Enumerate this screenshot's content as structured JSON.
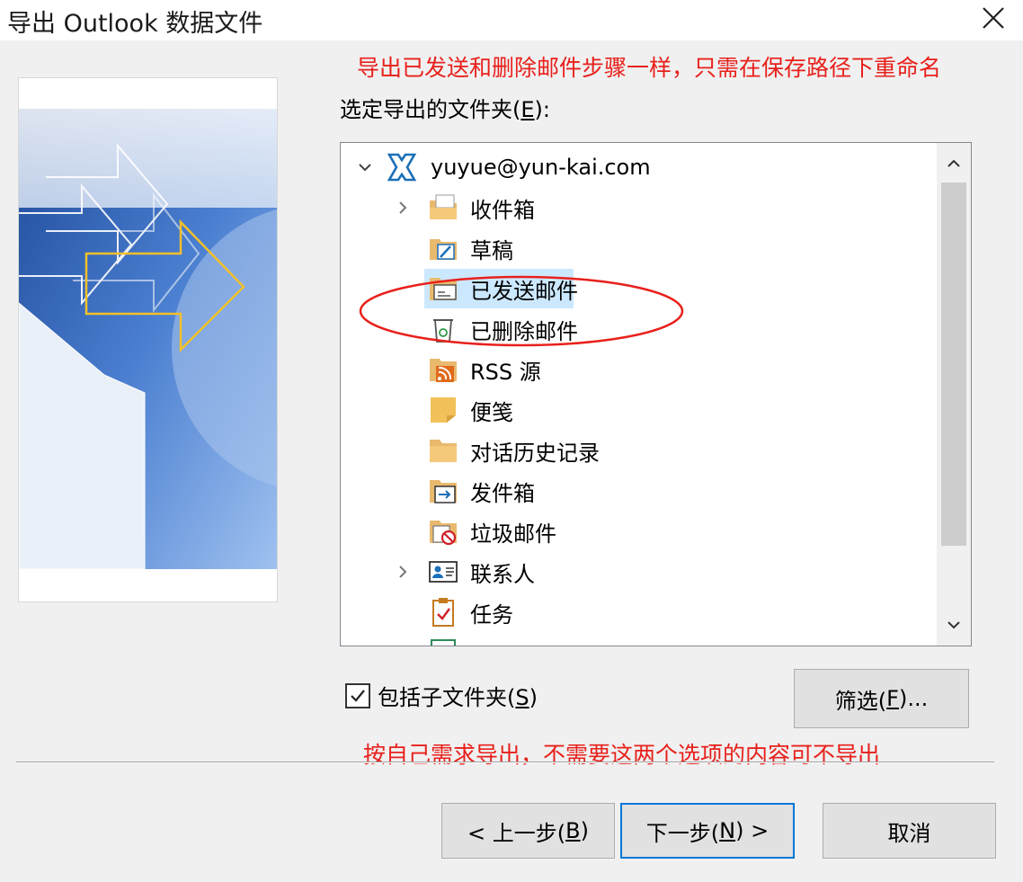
{
  "window": {
    "title": "导出 Outlook 数据文件",
    "close_icon": "close-icon"
  },
  "annotations": {
    "top": "导出已发送和删除邮件步骤一样，只需在保存路径下重命名",
    "bottom": "按自己需求导出，不需要这两个选项的内容可不导出"
  },
  "folder_picker": {
    "label_prefix": "选定导出的文件夹(",
    "label_key": "E",
    "label_suffix": "):",
    "account": "yuyue@yun-kai.com",
    "items": [
      {
        "label": "收件箱",
        "icon": "inbox-folder-icon",
        "expandable": true
      },
      {
        "label": "草稿",
        "icon": "drafts-folder-icon",
        "expandable": false
      },
      {
        "label": "已发送邮件",
        "icon": "sent-folder-icon",
        "expandable": false,
        "selected": true
      },
      {
        "label": "已删除邮件",
        "icon": "trash-icon",
        "expandable": false
      },
      {
        "label": "RSS 源",
        "icon": "rss-folder-icon",
        "expandable": false
      },
      {
        "label": "便笺",
        "icon": "notes-icon",
        "expandable": false
      },
      {
        "label": "对话历史记录",
        "icon": "folder-icon",
        "expandable": false
      },
      {
        "label": "发件箱",
        "icon": "outbox-folder-icon",
        "expandable": false
      },
      {
        "label": "垃圾邮件",
        "icon": "junk-folder-icon",
        "expandable": false
      },
      {
        "label": "联系人",
        "icon": "contacts-icon",
        "expandable": true
      },
      {
        "label": "任务",
        "icon": "tasks-icon",
        "expandable": false
      }
    ]
  },
  "include_subfolders": {
    "checked": true,
    "label_prefix": "包括子文件夹(",
    "label_key": "S",
    "label_suffix": ")"
  },
  "filter_button": {
    "prefix": "筛选(",
    "key": "F",
    "suffix": ")..."
  },
  "nav": {
    "back": {
      "prefix": "< 上一步(",
      "key": "B",
      "suffix": ")"
    },
    "next": {
      "prefix": "下一步(",
      "key": "N",
      "suffix": ") >"
    },
    "cancel": "取消"
  },
  "colors": {
    "annotation": "#e8201b",
    "selection": "#cce8ff",
    "focus": "#0078d7"
  }
}
